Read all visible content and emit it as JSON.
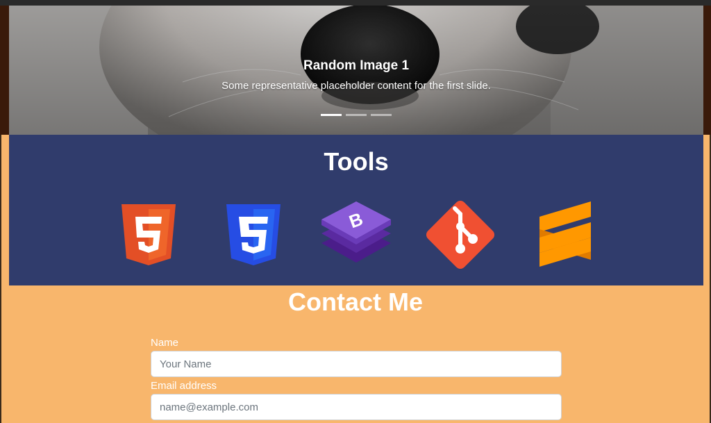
{
  "carousel": {
    "slide_title": "Random Image 1",
    "slide_text": "Some representative placeholder content for the first slide.",
    "indicators": [
      {
        "active": true
      },
      {
        "active": false
      },
      {
        "active": false
      }
    ]
  },
  "tools": {
    "heading": "Tools",
    "logos": [
      "html5-logo",
      "css3-logo",
      "bootstrap-logo",
      "git-logo",
      "sublime-text-logo"
    ]
  },
  "contact": {
    "heading": "Contact Me",
    "name_label": "Name",
    "name_placeholder": "Your Name",
    "email_label": "Email address",
    "email_placeholder": "name@example.com"
  },
  "colors": {
    "page_bg": "#f8b66c",
    "tools_bg": "#303c6c",
    "html5": "#e34f26",
    "css3": "#1572b6",
    "bootstrap": "#7952b3",
    "git": "#f05032",
    "sublime": "#ff9800"
  }
}
